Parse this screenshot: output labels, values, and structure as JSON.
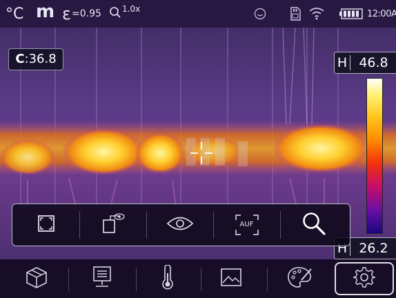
{
  "status": {
    "unit": "°C",
    "mode": "m",
    "emissivity_symbol": "ε",
    "emissivity_value": "=0.95",
    "zoom_value": "1.0x",
    "time": "12:00AM",
    "icons": [
      "smiley-icon",
      "sd-card-icon",
      "wifi-icon",
      "battery-icon"
    ]
  },
  "measurement": {
    "center_label": "C",
    "center_value": ":36.8",
    "high_label": "H",
    "high_value": "46.8",
    "low_label": "H",
    "low_value": "26.2",
    "palette": "iron",
    "palette_colors": [
      "#ffffff",
      "#fff27a",
      "#ffc41c",
      "#ff8a00",
      "#f2300c",
      "#c40e6c",
      "#6a0fa4",
      "#1b0680"
    ]
  },
  "submenu": {
    "items": [
      {
        "icon": "full-frame-icon"
      },
      {
        "icon": "picture-in-picture-icon"
      },
      {
        "icon": "visible-eye-icon"
      },
      {
        "icon": "auto-focus-icon",
        "label": "AUF"
      },
      {
        "icon": "zoom-magnifier-icon"
      }
    ]
  },
  "bottombar": {
    "items": [
      {
        "icon": "box-icon"
      },
      {
        "icon": "monitor-icon"
      },
      {
        "icon": "thermometer-icon"
      },
      {
        "icon": "image-icon"
      },
      {
        "icon": "palette-icon"
      },
      {
        "icon": "settings-gear-icon",
        "active": true
      }
    ]
  },
  "colors": {
    "accent_white": "#e2e0ea",
    "overlay_dark": "#0a0a19",
    "hot_yellow": "#ffd428",
    "cold_purple": "#4b2d8c"
  }
}
